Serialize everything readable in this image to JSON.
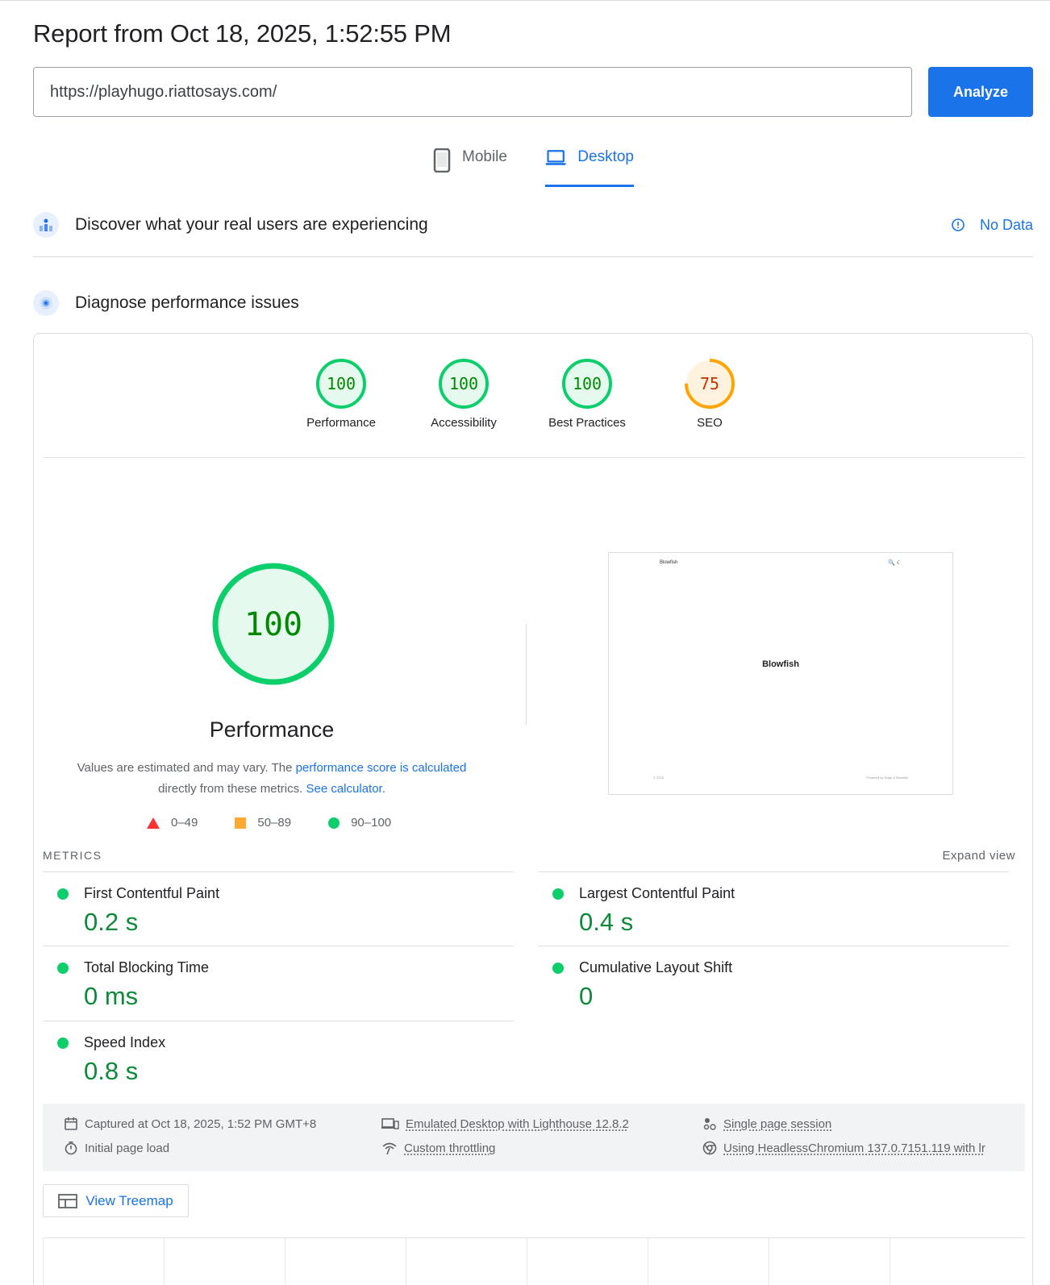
{
  "report": {
    "title": "Report from Oct 18, 2025, 1:52:55 PM"
  },
  "search": {
    "url": "https://playhugo.riattosays.com/",
    "analyze_label": "Analyze"
  },
  "tabs": [
    {
      "label": "Mobile",
      "icon": "smartphone-icon",
      "active": false
    },
    {
      "label": "Desktop",
      "icon": "laptop-icon",
      "active": true
    }
  ],
  "field_data": {
    "title": "Discover what your real users are experiencing",
    "status": "No Data"
  },
  "lab_data": {
    "title": "Diagnose performance issues"
  },
  "categories": [
    {
      "label": "Performance",
      "score": "100",
      "fraction": 1.0,
      "color": "#0cce6b",
      "bg": "#e6f9ef",
      "text": "#008800"
    },
    {
      "label": "Accessibility",
      "score": "100",
      "fraction": 1.0,
      "color": "#0cce6b",
      "bg": "#e6f9ef",
      "text": "#008800"
    },
    {
      "label": "Best Practices",
      "score": "100",
      "fraction": 1.0,
      "color": "#0cce6b",
      "bg": "#e6f9ef",
      "text": "#008800"
    },
    {
      "label": "SEO",
      "score": "75",
      "fraction": 0.75,
      "color": "#ffa400",
      "bg": "#fff3e0",
      "text": "#c33300"
    }
  ],
  "performance": {
    "score": "100",
    "title": "Performance",
    "desc_1": "Values are estimated and may vary. The ",
    "desc_link_1": "performance score is calculated",
    "desc_2": "directly from these metrics. ",
    "desc_link_2": "See calculator."
  },
  "legend": [
    {
      "shape": "triangle",
      "range": "0–49",
      "color": "#ff3333"
    },
    {
      "shape": "square",
      "range": "50–89",
      "color": "#ffaa33"
    },
    {
      "shape": "circle",
      "range": "90–100",
      "color": "#0cce6b"
    }
  ],
  "screenshot": {
    "brand": "Blowfish",
    "center_text": "Blowfish",
    "icons": "🔍 ☾",
    "footer_left": "© 2025",
    "footer_right": "Powered by Hugo & Blowfish"
  },
  "metrics": {
    "heading": "METRICS",
    "expand_label": "Expand view",
    "items": [
      {
        "label": "First Contentful Paint",
        "value": "0.2 s"
      },
      {
        "label": "Largest Contentful Paint",
        "value": "0.4 s"
      },
      {
        "label": "Total Blocking Time",
        "value": "0 ms"
      },
      {
        "label": "Cumulative Layout Shift",
        "value": "0"
      },
      {
        "label": "Speed Index",
        "value": "0.8 s"
      }
    ]
  },
  "runtime": {
    "captured": "Captured at Oct 18, 2025, 1:52 PM GMT+8",
    "initial_load": "Initial page load",
    "emulated": "Emulated Desktop with Lighthouse 12.8.2",
    "throttling": "Custom throttling",
    "session": "Single page session",
    "browser": "Using HeadlessChromium 137.0.7151.119 with lr"
  },
  "treemap_label": "View Treemap"
}
